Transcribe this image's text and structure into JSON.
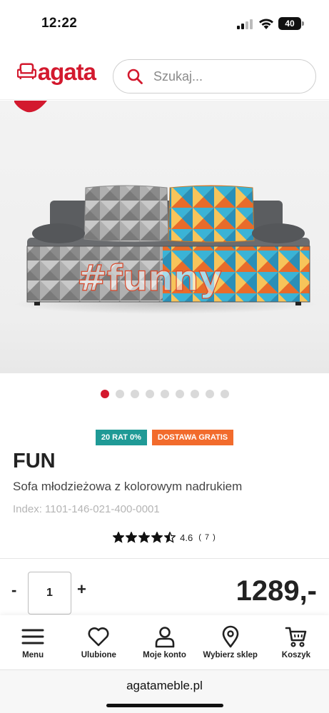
{
  "status_bar": {
    "time": "12:22",
    "battery": "40"
  },
  "header": {
    "logo_text": "agata",
    "search_placeholder": "Szukaj...",
    "brand_color": "#d3192e"
  },
  "gallery": {
    "image_text": "#funny",
    "dot_count": 9,
    "active_dot": 0
  },
  "badges": [
    {
      "label": "20 RAT 0%",
      "color": "#1f9a96"
    },
    {
      "label": "DOSTAWA GRATIS",
      "color": "#f26b2c"
    }
  ],
  "product": {
    "name": "FUN",
    "description": "Sofa młodzieżowa z kolorowym nadrukiem",
    "index": "Index: 1101-146-021-400-0001",
    "rating": "4.6",
    "rating_value": 4.6,
    "review_count": "( 7 )",
    "quantity_minus": "-",
    "quantity": "1",
    "quantity_plus": "+",
    "price": "1289,-"
  },
  "bottom_nav": [
    {
      "label": "Menu",
      "icon": "menu-icon"
    },
    {
      "label": "Ulubione",
      "icon": "heart-icon"
    },
    {
      "label": "Moje konto",
      "icon": "user-icon"
    },
    {
      "label": "Wybierz sklep",
      "icon": "location-pin-icon"
    },
    {
      "label": "Koszyk",
      "icon": "cart-icon"
    }
  ],
  "browser": {
    "url": "agatameble.pl"
  }
}
